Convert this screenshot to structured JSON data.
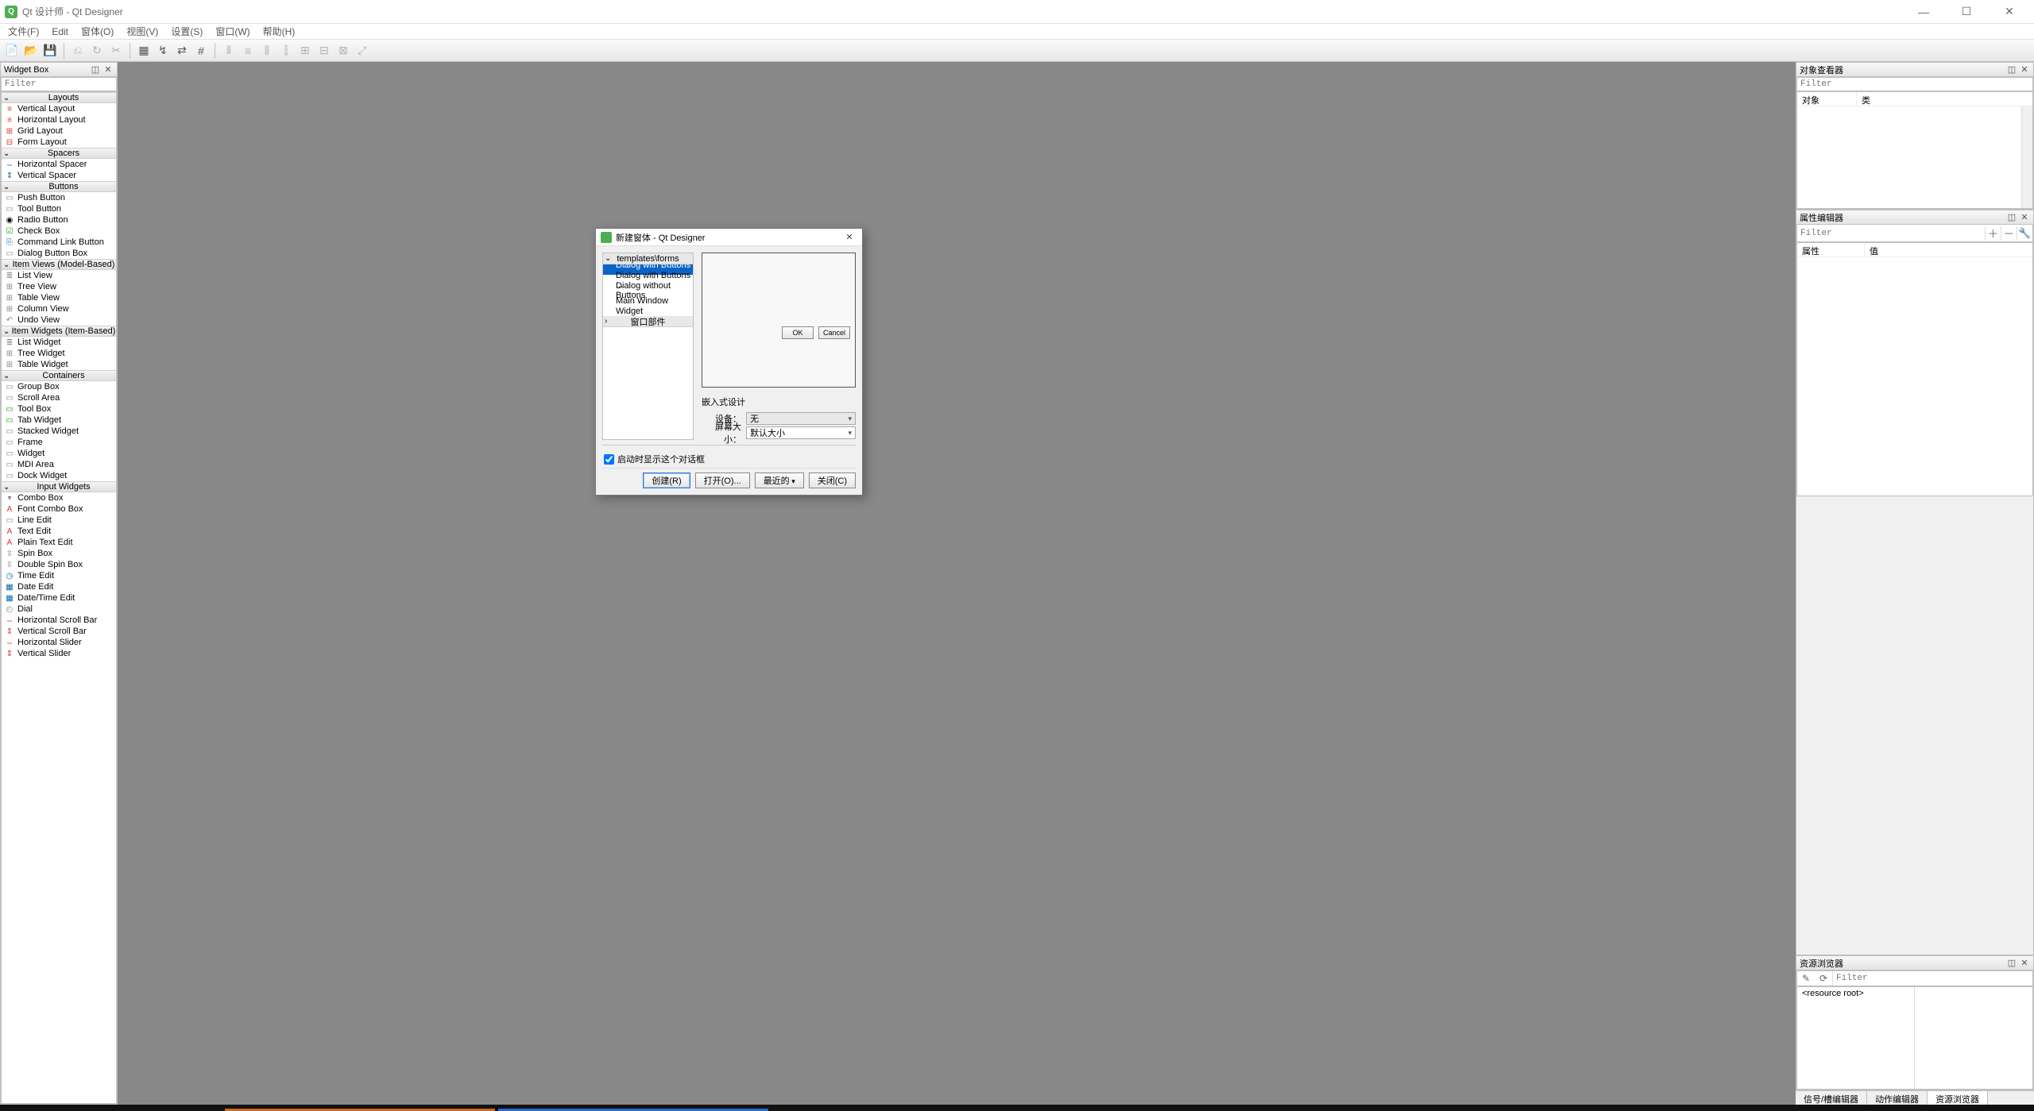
{
  "app": {
    "title": "Qt 设计师 - Qt Designer"
  },
  "window_controls": {
    "min": "—",
    "max": "☐",
    "close": "✕"
  },
  "menubar": [
    "文件(F)",
    "Edit",
    "窗体(O)",
    "视图(V)",
    "设置(S)",
    "窗口(W)",
    "帮助(H)"
  ],
  "widget_box": {
    "title": "Widget Box",
    "filter_placeholder": "Filter",
    "categories": [
      {
        "name": "Layouts",
        "items": [
          {
            "icon": "≡",
            "color": "#d33",
            "label": "Vertical Layout"
          },
          {
            "icon": "≡",
            "color": "#d33",
            "label": "Horizontal Layout"
          },
          {
            "icon": "⊞",
            "color": "#d33",
            "label": "Grid Layout"
          },
          {
            "icon": "⊟",
            "color": "#d33",
            "label": "Form Layout"
          }
        ]
      },
      {
        "name": "Spacers",
        "items": [
          {
            "icon": "⇔",
            "color": "#06a",
            "label": "Horizontal Spacer"
          },
          {
            "icon": "⇕",
            "color": "#06a",
            "label": "Vertical Spacer"
          }
        ]
      },
      {
        "name": "Buttons",
        "items": [
          {
            "icon": "▭",
            "color": "#888",
            "label": "Push Button"
          },
          {
            "icon": "▭",
            "color": "#888",
            "label": "Tool Button"
          },
          {
            "icon": "◉",
            "color": "#000",
            "label": "Radio Button"
          },
          {
            "icon": "☑",
            "color": "#0a0",
            "label": "Check Box"
          },
          {
            "icon": "⎘",
            "color": "#06a",
            "label": "Command Link Button"
          },
          {
            "icon": "▭",
            "color": "#888",
            "label": "Dialog Button Box"
          }
        ]
      },
      {
        "name": "Item Views (Model-Based)",
        "items": [
          {
            "icon": "≣",
            "color": "#888",
            "label": "List View"
          },
          {
            "icon": "⊞",
            "color": "#888",
            "label": "Tree View"
          },
          {
            "icon": "⊞",
            "color": "#888",
            "label": "Table View"
          },
          {
            "icon": "⊞",
            "color": "#888",
            "label": "Column View"
          },
          {
            "icon": "↶",
            "color": "#888",
            "label": "Undo View"
          }
        ]
      },
      {
        "name": "Item Widgets (Item-Based)",
        "items": [
          {
            "icon": "≣",
            "color": "#888",
            "label": "List Widget"
          },
          {
            "icon": "⊞",
            "color": "#888",
            "label": "Tree Widget"
          },
          {
            "icon": "⊞",
            "color": "#888",
            "label": "Table Widget"
          }
        ]
      },
      {
        "name": "Containers",
        "items": [
          {
            "icon": "▭",
            "color": "#888",
            "label": "Group Box"
          },
          {
            "icon": "▭",
            "color": "#888",
            "label": "Scroll Area"
          },
          {
            "icon": "▭",
            "color": "#0a0",
            "label": "Tool Box"
          },
          {
            "icon": "▭",
            "color": "#0a0",
            "label": "Tab Widget"
          },
          {
            "icon": "▭",
            "color": "#888",
            "label": "Stacked Widget"
          },
          {
            "icon": "▭",
            "color": "#888",
            "label": "Frame"
          },
          {
            "icon": "▭",
            "color": "#888",
            "label": "Widget"
          },
          {
            "icon": "▭",
            "color": "#888",
            "label": "MDI Area"
          },
          {
            "icon": "▭",
            "color": "#888",
            "label": "Dock Widget"
          }
        ]
      },
      {
        "name": "Input Widgets",
        "items": [
          {
            "icon": "▾",
            "color": "#888",
            "label": "Combo Box"
          },
          {
            "icon": "A",
            "color": "#d33",
            "label": "Font Combo Box"
          },
          {
            "icon": "▭",
            "color": "#888",
            "label": "Line Edit"
          },
          {
            "icon": "A",
            "color": "#d33",
            "label": "Text Edit"
          },
          {
            "icon": "A",
            "color": "#d33",
            "label": "Plain Text Edit"
          },
          {
            "icon": "⇳",
            "color": "#888",
            "label": "Spin Box"
          },
          {
            "icon": "⇳",
            "color": "#888",
            "label": "Double Spin Box"
          },
          {
            "icon": "◷",
            "color": "#06a",
            "label": "Time Edit"
          },
          {
            "icon": "▦",
            "color": "#06a",
            "label": "Date Edit"
          },
          {
            "icon": "▦",
            "color": "#06a",
            "label": "Date/Time Edit"
          },
          {
            "icon": "◴",
            "color": "#888",
            "label": "Dial"
          },
          {
            "icon": "⇔",
            "color": "#d33",
            "label": "Horizontal Scroll Bar"
          },
          {
            "icon": "⇕",
            "color": "#d33",
            "label": "Vertical Scroll Bar"
          },
          {
            "icon": "⇔",
            "color": "#d33",
            "label": "Horizontal Slider"
          },
          {
            "icon": "⇕",
            "color": "#d33",
            "label": "Vertical Slider"
          }
        ]
      }
    ]
  },
  "object_inspector": {
    "title": "对象查看器",
    "filter_placeholder": "Filter",
    "col_object": "对象",
    "col_class": "类"
  },
  "property_editor": {
    "title": "属性编辑器",
    "filter_placeholder": "Filter",
    "col_property": "属性",
    "col_value": "值"
  },
  "resource_browser": {
    "title": "资源浏览器",
    "filter_placeholder": "Filter",
    "root": "<resource root>"
  },
  "right_tabs": {
    "signal": "信号/槽编辑器",
    "action": "动作编辑器",
    "resource": "资源浏览器"
  },
  "dialog": {
    "title": "新建窗体 - Qt Designer",
    "tree_group1": "templates\\forms",
    "tree_items": [
      "Dialog with Buttons ...",
      "Dialog with Buttons ...",
      "Dialog without Buttons",
      "Main Window",
      "Widget"
    ],
    "tree_group2": "窗口部件",
    "preview_ok": "OK",
    "preview_cancel": "Cancel",
    "embed_title": "嵌入式设计",
    "device_label": "设备：",
    "device_value": "无",
    "screen_label": "屏幕大小：",
    "screen_value": "默认大小",
    "checkbox_label": "启动时显示这个对话框",
    "btn_create": "创建(R)",
    "btn_open": "打开(O)...",
    "btn_recent": "最近的",
    "btn_close": "关闭(C)"
  }
}
